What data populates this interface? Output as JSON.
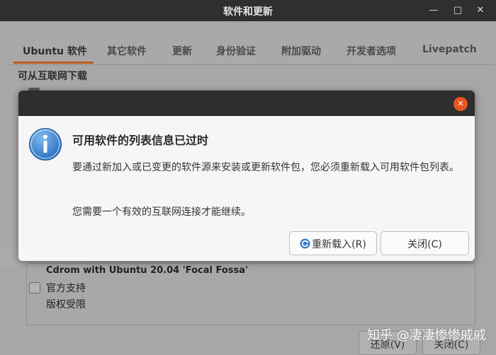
{
  "window": {
    "title": "软件和更新",
    "minimize_icon": "minimize-icon",
    "maximize_icon": "maximize-icon",
    "close_icon": "close-icon"
  },
  "tabs": [
    {
      "label": "Ubuntu 软件",
      "active": true
    },
    {
      "label": "其它软件"
    },
    {
      "label": "更新"
    },
    {
      "label": "身份验证"
    },
    {
      "label": "附加驱动"
    },
    {
      "label": "开发者选项"
    },
    {
      "label": "Livepatch"
    }
  ],
  "section": {
    "download_from_internet": "可从互联网下载"
  },
  "sources": {
    "cdrom_title": "Cdrom with Ubuntu 20.04 'Focal Fossa'",
    "items": [
      "官方支持",
      "版权受限"
    ]
  },
  "bottom_buttons": {
    "revert": "还原(V)",
    "close": "关闭(C)"
  },
  "dialog": {
    "icon": "info-icon",
    "title": "可用软件的列表信息已过时",
    "message": "要通过新加入或已变更的软件源来安装或更新软件包，您必须重新载入可用软件包列表。",
    "note": "您需要一个有效的互联网连接才能继续。",
    "reload_button": "重新载入(R)",
    "close_button": "关闭(C)",
    "accent_color": "#e95420"
  },
  "watermark": "知乎 @凄凄惨惨戚戚"
}
